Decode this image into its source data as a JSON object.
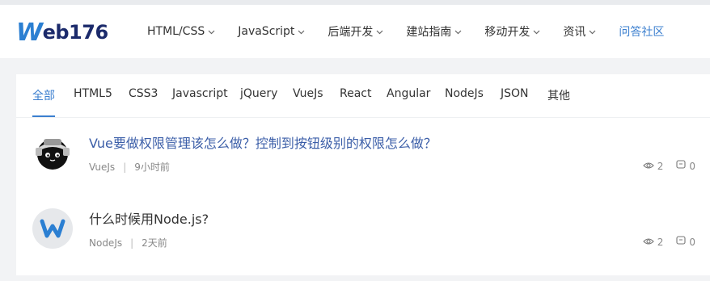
{
  "logo": {
    "text_w": "W",
    "text_rest": "eb176"
  },
  "nav": [
    {
      "label": "HTML/CSS",
      "dropdown": true
    },
    {
      "label": "JavaScript",
      "dropdown": true
    },
    {
      "label": "后端开发",
      "dropdown": true
    },
    {
      "label": "建站指南",
      "dropdown": true
    },
    {
      "label": "移动开发",
      "dropdown": true
    },
    {
      "label": "资讯",
      "dropdown": true
    },
    {
      "label": "问答社区",
      "dropdown": false,
      "active": true
    }
  ],
  "tabs": [
    "全部",
    "HTML5",
    "CSS3",
    "Javascript",
    "jQuery",
    "VueJs",
    "React",
    "Angular",
    "NodeJs",
    "JSON",
    "其他"
  ],
  "active_tab": "全部",
  "questions": [
    {
      "title": "Vue要做权限管理该怎么做？控制到按钮级别的权限怎么做？",
      "tag": "VueJs",
      "time": "9小时前",
      "views": "2",
      "answers": "0",
      "avatar": "ninja-avatar",
      "title_color": "#3b5ea8"
    },
    {
      "title": "什么时候用Node.js?",
      "tag": "NodeJs",
      "time": "2天前",
      "views": "2",
      "answers": "0",
      "avatar": "web176-logo-avatar",
      "title_color": "#333333"
    }
  ],
  "colors": {
    "accent": "#3b7fcf",
    "brand_dark": "#1b2a6b",
    "muted": "#888888"
  }
}
